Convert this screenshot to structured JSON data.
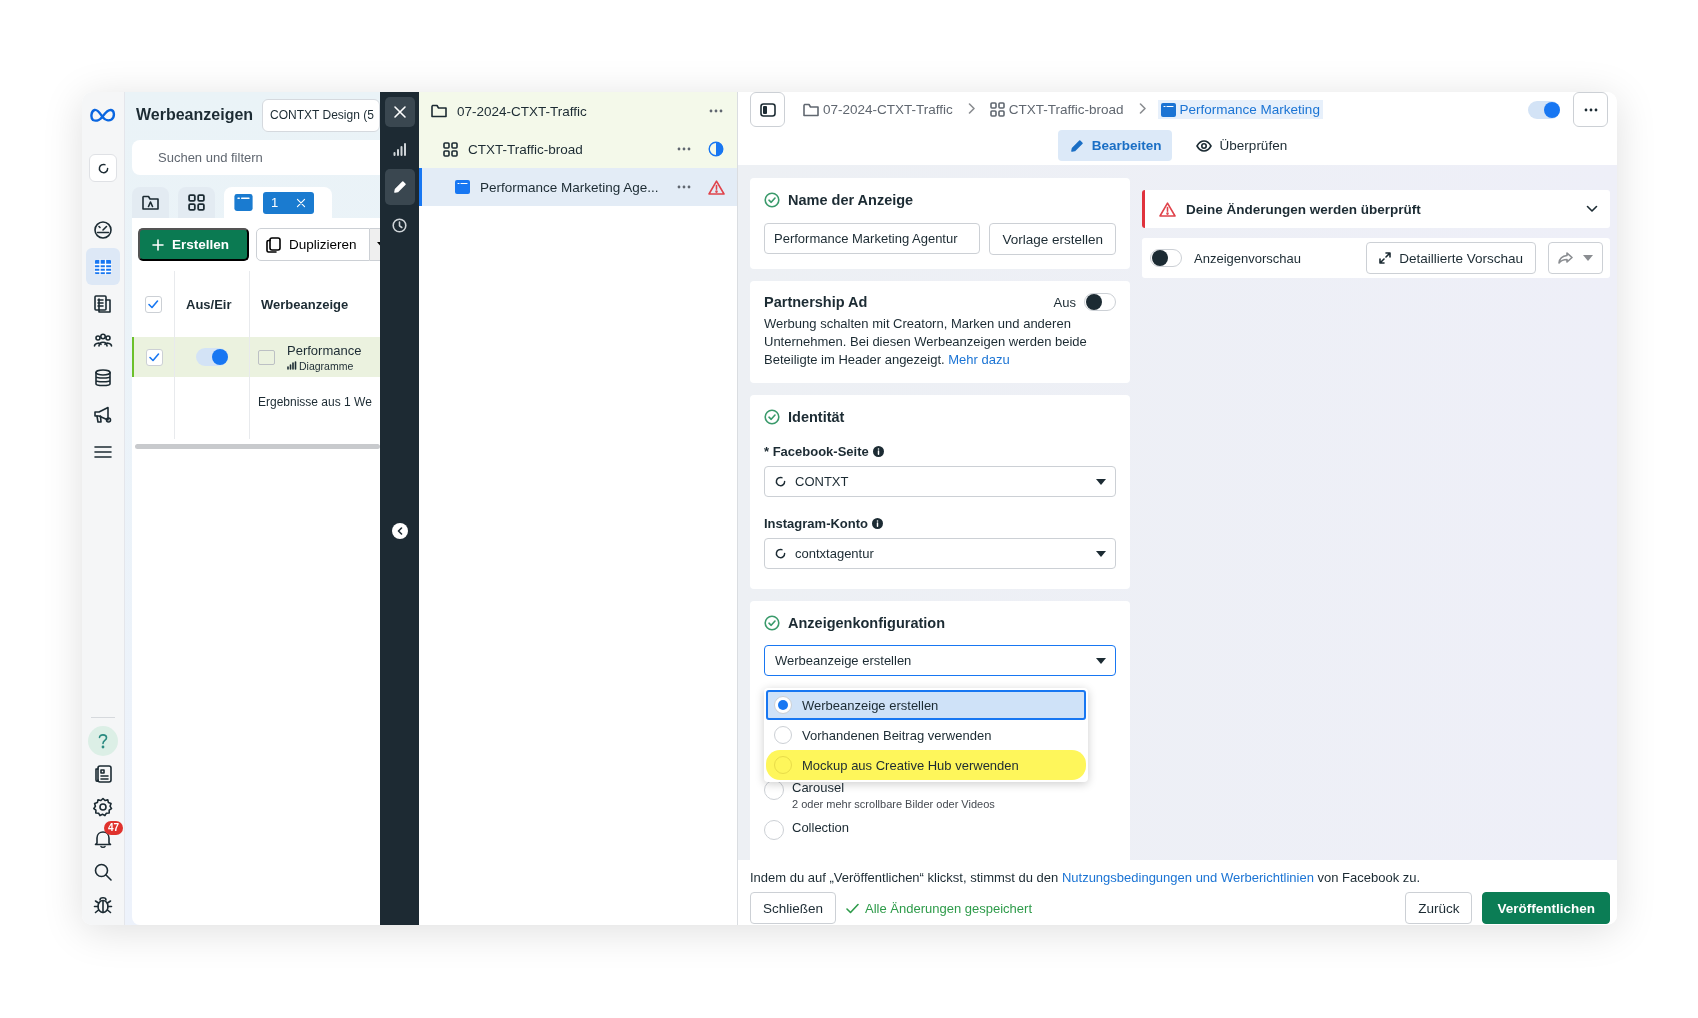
{
  "nav_rail": {
    "top_items": [
      {
        "selected": false
      },
      {
        "selected": true
      },
      {
        "selected": false
      },
      {
        "selected": false
      },
      {
        "selected": false
      },
      {
        "selected": false
      },
      {
        "selected": false
      }
    ],
    "bottom_items": [
      {
        "selected": true
      },
      {
        "selected": false
      },
      {
        "selected": false
      },
      {
        "selected": false
      },
      {
        "selected": false
      },
      {
        "selected": false
      }
    ],
    "notification_count": "47"
  },
  "ads_panel": {
    "title": "Werbeanzeigen",
    "account": "CONTXT Design (5",
    "search": {
      "placeholder": "Suchen und filtern"
    },
    "level_tabs": [
      {
        "selected": false
      },
      {
        "selected": false
      },
      {
        "selected": true
      }
    ],
    "selection_count": "1",
    "create_button": "Erstellen",
    "duplicate_button": "Duplizieren",
    "table": {
      "all_checked": true,
      "columns": [
        "Aus/Eir",
        "Werbeanzeige"
      ],
      "rows": [
        {
          "checked": true,
          "on": true,
          "name": "Performance",
          "subtitle": "Diagramme"
        }
      ],
      "footer": "Ergebnisse aus 1 We"
    }
  },
  "tool_strip": {
    "items": [
      {
        "selected": false
      },
      {
        "selected": true
      },
      {
        "selected": false
      }
    ]
  },
  "tree": {
    "items": [
      {
        "kind": "campaign",
        "label": "07-2024-CTXT-Traffic",
        "selected": false,
        "children": [
          {
            "kind": "ad_set",
            "label": "CTXT-Traffic-broad",
            "selected": false,
            "children": [
              {
                "kind": "ad",
                "label": "Performance Marketing Age...",
                "selected": true
              }
            ]
          }
        ]
      }
    ]
  },
  "header": {
    "breadcrumbs": [
      {
        "label": "07-2024-CTXT-Traffic",
        "selected": false
      },
      {
        "label": "CTXT-Traffic-broad",
        "selected": false
      },
      {
        "label": "Performance Marketing",
        "selected": true
      }
    ],
    "active_toggle": {
      "on": true
    },
    "mode_tabs": [
      {
        "label": "Bearbeiten",
        "selected": true
      },
      {
        "label": "Überprüfen",
        "selected": false
      }
    ]
  },
  "ad_name": {
    "title": "Name der Anzeige",
    "complete": true,
    "value": "Performance Marketing Agentur",
    "template_button": "Vorlage erstellen"
  },
  "partnership": {
    "title": "Partnership Ad",
    "status": "Aus",
    "on": false,
    "description": "Werbung schalten mit Creatorn, Marken und anderen Unternehmen. Bei diesen Werbeanzeigen werden beide Beteiligte im Header angezeigt.",
    "link": "Mehr dazu"
  },
  "identity": {
    "title": "Identität",
    "complete": true,
    "fields": [
      {
        "label": "* Facebook-Seite",
        "value": "CONTXT"
      },
      {
        "label": "Instagram-Konto",
        "value": "contxtagentur"
      }
    ]
  },
  "ad_config": {
    "title": "Anzeigenkonfiguration",
    "complete": true,
    "select_value": "Werbeanzeige erstellen",
    "menu": [
      {
        "label": "Werbeanzeige erstellen",
        "selected": true,
        "highlighted": false
      },
      {
        "label": "Vorhandenen Beitrag verwenden",
        "selected": false,
        "highlighted": false
      },
      {
        "label": "Mockup aus Creative Hub verwenden",
        "selected": false,
        "highlighted": true
      }
    ],
    "formats": [
      {
        "label": "Carousel",
        "description": "2 oder mehr scrollbare Bilder oder Videos",
        "selected": false
      },
      {
        "label": "Collection",
        "selected": false
      }
    ]
  },
  "review_banner": {
    "title": "Deine Änderungen werden überprüft",
    "expanded": false
  },
  "preview": {
    "on": false,
    "label": "Anzeigenvorschau",
    "detail_button": "Detaillierte Vorschau"
  },
  "footer": {
    "terms_before": "Indem du auf „Veröffentlichen“ klickst, stimmst du den ",
    "terms_link": "Nutzungsbedingungen und Werberichtlinien",
    "terms_after": " von Facebook zu.",
    "close_button": "Schließen",
    "saved_status": "Alle Änderungen gespeichert",
    "back_button": "Zurück",
    "publish_button": "Veröffentlichen"
  }
}
